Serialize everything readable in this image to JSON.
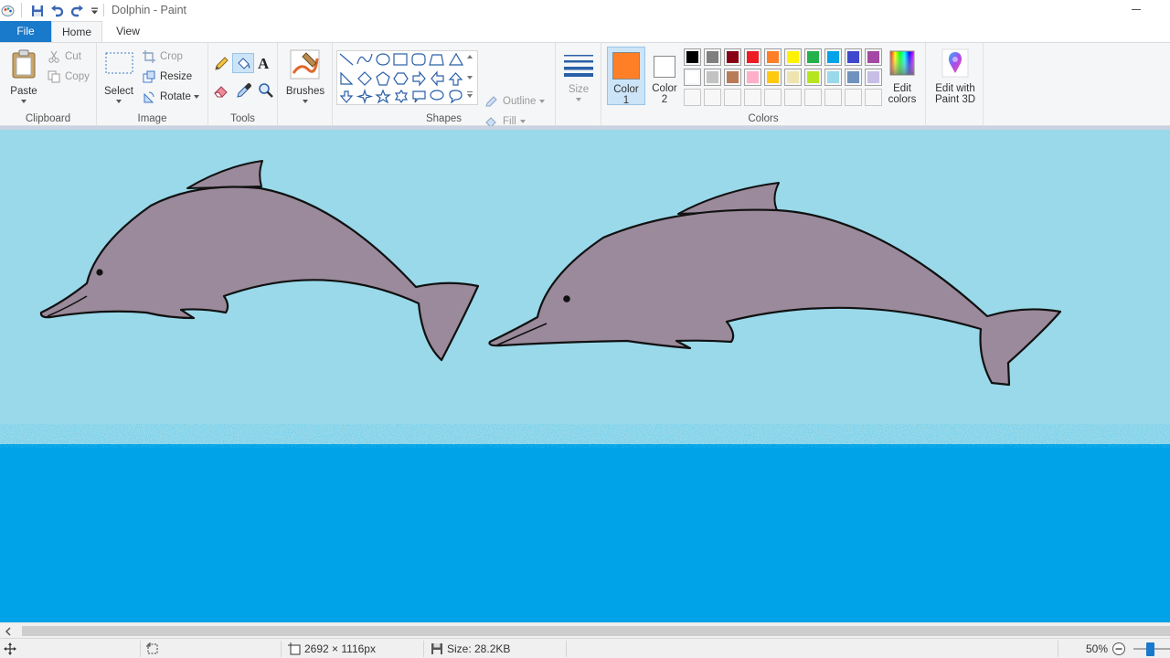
{
  "window": {
    "title": "Dolphin - Paint"
  },
  "tabs": {
    "file": "File",
    "home": "Home",
    "view": "View"
  },
  "ribbon": {
    "clipboard": {
      "label": "Clipboard",
      "paste": "Paste",
      "cut": "Cut",
      "copy": "Copy"
    },
    "image": {
      "label": "Image",
      "select": "Select",
      "crop": "Crop",
      "resize": "Resize",
      "rotate": "Rotate"
    },
    "tools": {
      "label": "Tools"
    },
    "brushes": {
      "label": "Brushes"
    },
    "shapes": {
      "label": "Shapes",
      "outline": "Outline",
      "fill": "Fill"
    },
    "size": {
      "label": "Size"
    },
    "colors": {
      "label": "Colors",
      "color1_line1": "Color",
      "color1_line2": "1",
      "color2_line1": "Color",
      "color2_line2": "2",
      "edit_line1": "Edit",
      "edit_line2": "colors",
      "color1_value": "#ff7f27",
      "color2_value": "#ffffff",
      "palette_row1": [
        "#000000",
        "#7f7f7f",
        "#880015",
        "#ed1c24",
        "#ff7f27",
        "#fff200",
        "#22b14c",
        "#00a2e8",
        "#3f48cc",
        "#a349a4"
      ],
      "palette_row2": [
        "#ffffff",
        "#c3c3c3",
        "#b97a57",
        "#ffaec9",
        "#ffc90e",
        "#efe4b0",
        "#b5e61d",
        "#99d9ea",
        "#7092be",
        "#c8bfe7"
      ]
    },
    "paint3d": {
      "line1": "Edit with",
      "line2": "Paint 3D"
    }
  },
  "canvas": {
    "sky_color": "#99d9ea",
    "sea_color": "#00a2e8",
    "dolphin_color": "#9a8a9b",
    "dolphins": [
      "dolphin-left",
      "dolphin-right"
    ]
  },
  "status": {
    "dimensions": "2692 × 1116px",
    "size": "Size: 28.2KB",
    "zoom": "50%",
    "zoom_level": 0.5
  }
}
